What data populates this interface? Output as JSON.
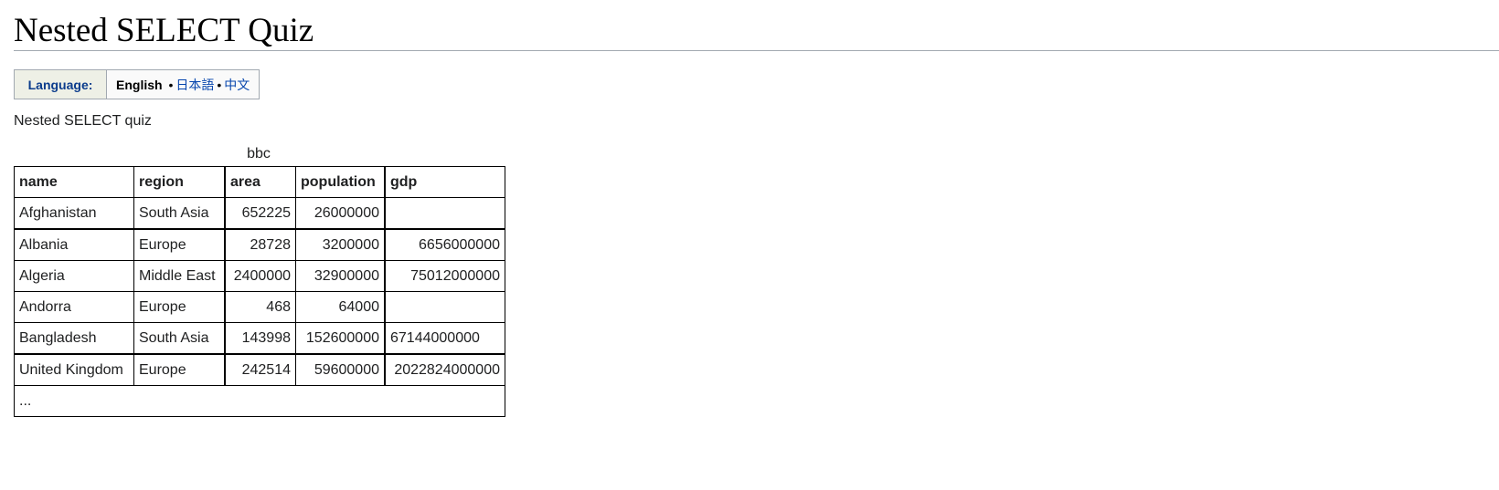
{
  "page": {
    "title": "Nested SELECT Quiz",
    "description": "Nested SELECT quiz"
  },
  "language_bar": {
    "label": "Language:",
    "current": "English",
    "separator": "•",
    "options": [
      "日本語",
      "中文"
    ]
  },
  "table": {
    "caption": "bbc",
    "columns": [
      "name",
      "region",
      "area",
      "population",
      "gdp"
    ],
    "rows": [
      {
        "name": "Afghanistan",
        "region": "South Asia",
        "area": "652225",
        "population": "26000000",
        "gdp": ""
      },
      {
        "name": "Albania",
        "region": "Europe",
        "area": "28728",
        "population": "3200000",
        "gdp": "6656000000"
      },
      {
        "name": "Algeria",
        "region": "Middle East",
        "area": "2400000",
        "population": "32900000",
        "gdp": "75012000000"
      },
      {
        "name": "Andorra",
        "region": "Europe",
        "area": "468",
        "population": "64000",
        "gdp": ""
      },
      {
        "name": "Bangladesh",
        "region": "South Asia",
        "area": "143998",
        "population": "152600000",
        "gdp": "67144000000"
      },
      {
        "name": "United Kingdom",
        "region": "Europe",
        "area": "242514",
        "population": "59600000",
        "gdp": "2022824000000"
      }
    ],
    "ellipsis": "..."
  },
  "colors": {
    "link": "#0645ad",
    "label_text": "#0b3c8c",
    "label_bg": "#eef0e6",
    "rule": "#a2a9b1"
  }
}
